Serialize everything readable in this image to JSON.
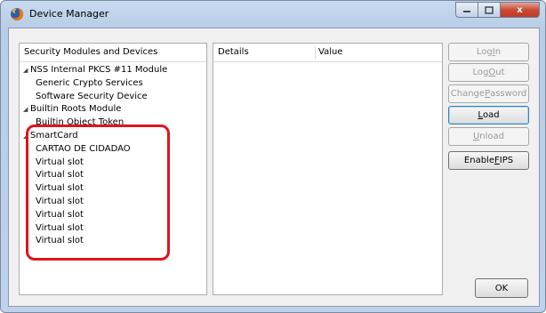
{
  "window": {
    "title": "Device Manager",
    "close_glyph": "x"
  },
  "tree": {
    "header": "Security Modules and Devices",
    "rows": [
      {
        "label": "NSS Internal PKCS #11 Module",
        "level": 0
      },
      {
        "label": "Generic Crypto Services",
        "level": 1
      },
      {
        "label": "Software Security Device",
        "level": 1
      },
      {
        "label": "Builtin Roots Module",
        "level": 0
      },
      {
        "label": "Builtin Object Token",
        "level": 1
      },
      {
        "label": "SmartCard",
        "level": 0
      },
      {
        "label": "CARTAO DE CIDADAO",
        "level": 1
      },
      {
        "label": "Virtual slot",
        "level": 1
      },
      {
        "label": "Virtual slot",
        "level": 1
      },
      {
        "label": "Virtual slot",
        "level": 1
      },
      {
        "label": "Virtual slot",
        "level": 1
      },
      {
        "label": "Virtual slot",
        "level": 1
      },
      {
        "label": "Virtual slot",
        "level": 1
      },
      {
        "label": "Virtual slot",
        "level": 1
      }
    ]
  },
  "details": {
    "col_details": "Details",
    "col_value": "Value"
  },
  "buttons": {
    "log_in": {
      "pre": "Log ",
      "key": "I",
      "post": "n"
    },
    "log_out": {
      "pre": "Log ",
      "key": "O",
      "post": "ut"
    },
    "change_password": {
      "pre": "Change ",
      "key": "P",
      "post": "assword"
    },
    "load": {
      "pre": "",
      "key": "L",
      "post": "oad"
    },
    "unload": {
      "pre": "",
      "key": "U",
      "post": "nload"
    },
    "enable_fips": {
      "pre": "Enable ",
      "key": "F",
      "post": "IPS"
    },
    "ok": "OK"
  },
  "colors": {
    "highlight": "#e0141d",
    "title_bar": "#c7daf0"
  }
}
